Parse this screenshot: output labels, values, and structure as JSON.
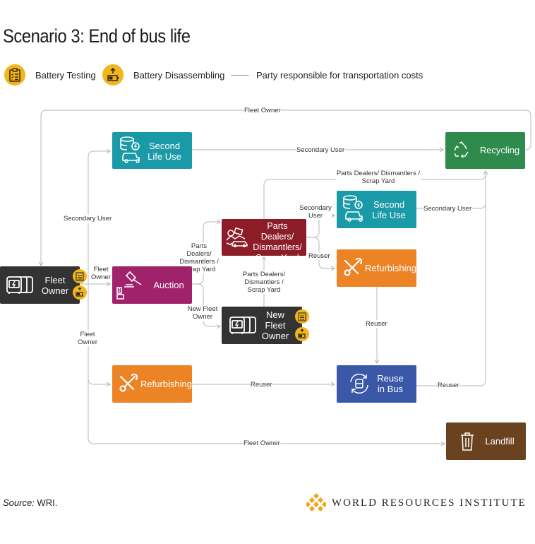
{
  "title": "Scenario 3: End of bus life",
  "legend": {
    "items": [
      {
        "icon": "clipboard-checklist-icon",
        "label": "Battery Testing"
      },
      {
        "icon": "battery-upload-icon",
        "label": "Battery Disassembling"
      },
      {
        "icon": "line-icon",
        "label": "Party responsible for transportation costs"
      }
    ]
  },
  "colors": {
    "fleet_owner": "#333333",
    "second_life": "#1a99a6",
    "auction": "#a0226a",
    "parts_dealers": "#8b1c28",
    "refurbishing": "#ec8426",
    "recycling": "#2e8b4c",
    "reuse_bus": "#3a57a8",
    "landfill": "#6b4220",
    "badge": "#f2b619",
    "edge": "#b8b8b8"
  },
  "nodes": {
    "fleet_owner": {
      "label": "Fleet Owner",
      "icon": "electric-bus-fleet-icon"
    },
    "second_life_top": {
      "label": "Second Life Use",
      "icon": "battery-storage-rickshaw-icon"
    },
    "auction": {
      "label": "Auction",
      "icon": "gavel-icon"
    },
    "parts_dealers": {
      "label": "Parts Dealers/ Dismantlers/ Scrap Yard",
      "icon": "scrap-pile-icon"
    },
    "new_fleet_owner": {
      "label": "New Fleet Owner",
      "icon": "electric-bus-fleet-icon"
    },
    "second_life_right": {
      "label": "Second Life Use",
      "icon": "battery-storage-rickshaw-icon"
    },
    "refurbishing_right": {
      "label": "Refurbishing",
      "icon": "wrench-screwdriver-icon"
    },
    "recycling": {
      "label": "Recycling",
      "icon": "recycle-icon"
    },
    "refurbishing_bottom": {
      "label": "Refurbishing",
      "icon": "wrench-screwdriver-icon"
    },
    "reuse_bus": {
      "label": "Reuse in Bus",
      "icon": "bus-cycle-icon"
    },
    "landfill": {
      "label": "Landfill",
      "icon": "trash-bin-icon"
    }
  },
  "edge_labels": {
    "fleet_owner_to_recycling": "Fleet Owner",
    "second_life_to_recycling": "Secondary User",
    "fleet_to_second_life": "Secondary User",
    "fleet_to_auction": "Fleet Owner",
    "auction_to_parts": "Parts Dealers/ Dismantlers / Scrap Yard",
    "auction_to_new_fleet": "New Fleet Owner",
    "new_fleet_to_parts": "Parts Dealers/ Dismantlers / Scrap Yard",
    "parts_to_recycling": "Parts Dealers/ Dismantlers / Scrap Yard",
    "parts_to_second_life": "Secondary User",
    "parts_to_refurb": "Reuser",
    "second_life_right_to_recycling": "Secondary User",
    "refurb_to_reuse": "Reuser",
    "fleet_to_refurb_bottom": "Fleet Owner",
    "refurb_bottom_to_reuse": "Reuser",
    "reuse_to_recycling": "Reuser",
    "fleet_to_landfill": "Fleet Owner"
  },
  "footer": {
    "source_label": "Source:",
    "source_value": " WRI.",
    "org_name": "WORLD RESOURCES INSTITUTE"
  }
}
